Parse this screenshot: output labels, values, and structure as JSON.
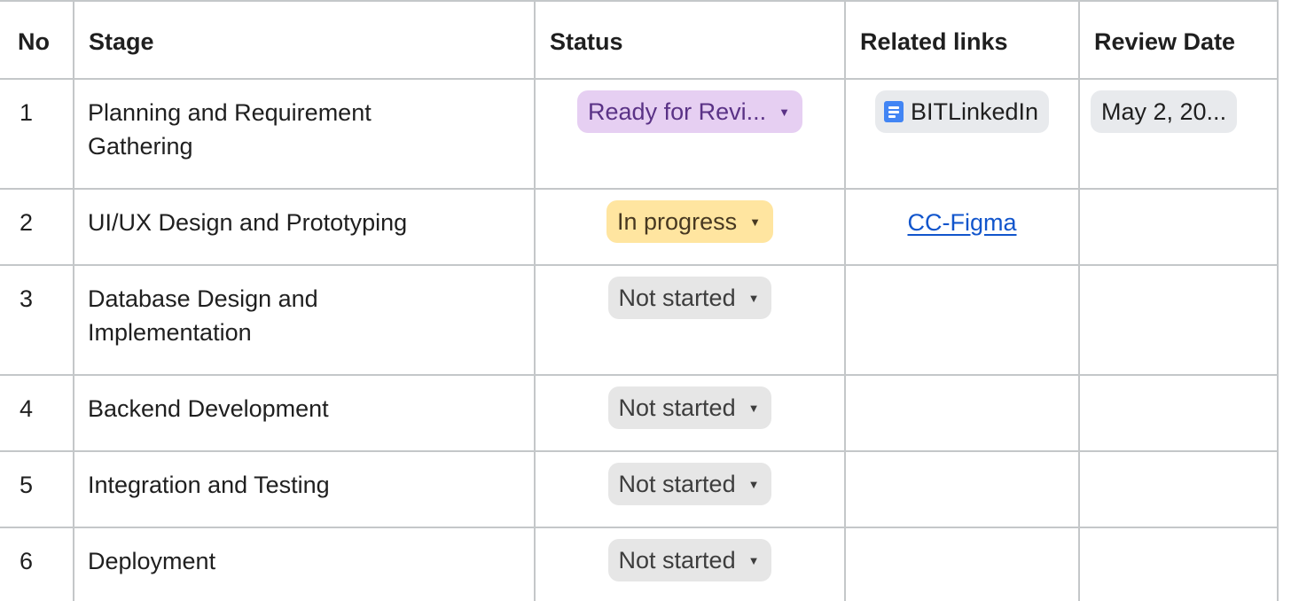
{
  "headers": {
    "no": "No",
    "stage": "Stage",
    "status": "Status",
    "links": "Related links",
    "date": "Review Date"
  },
  "rows": [
    {
      "no": "1",
      "stage": "Planning and Requirement Gathering",
      "status": "Ready for Revi...",
      "link": "BITLinkedIn",
      "date": "May 2, 20..."
    },
    {
      "no": "2",
      "stage": "UI/UX Design and Prototyping",
      "status": "In progress",
      "link": "CC-Figma",
      "date": ""
    },
    {
      "no": "3",
      "stage": "Database Design and Implementation",
      "status": "Not started",
      "link": "",
      "date": ""
    },
    {
      "no": "4",
      "stage": "Backend Development",
      "status": "Not started",
      "link": "",
      "date": ""
    },
    {
      "no": "5",
      "stage": "Integration and Testing",
      "status": "Not started",
      "link": "",
      "date": ""
    },
    {
      "no": "6",
      "stage": "Deployment",
      "status": "Not started",
      "link": "",
      "date": ""
    }
  ],
  "icons": {
    "dropdown": "caret-down-icon",
    "doc": "google-doc-icon"
  },
  "colors": {
    "review_chip_bg": "#e6cff2",
    "progress_chip_bg": "#ffe5a0",
    "notstarted_chip_bg": "#e6e6e6",
    "link": "#1155cc",
    "doc_icon": "#4285f4"
  }
}
